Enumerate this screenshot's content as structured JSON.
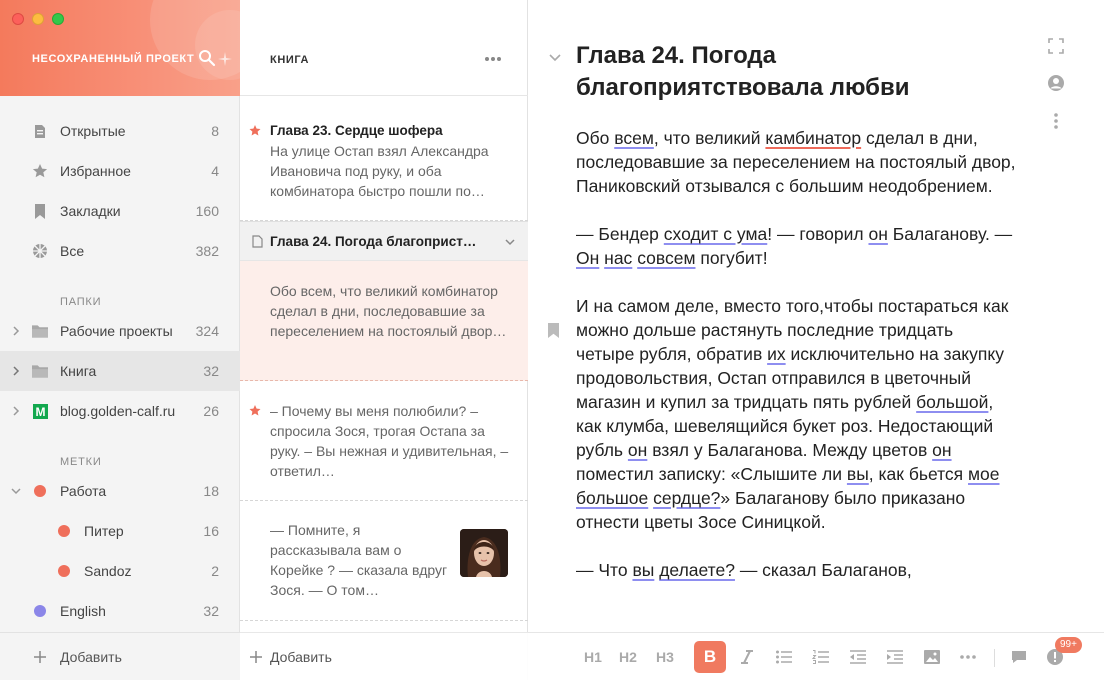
{
  "sidebar": {
    "project_title": "НЕСОХРАНЕННЫЙ ПРОЕКТ",
    "items": [
      {
        "label": "Открытые",
        "count": "8",
        "icon": "doc-icon"
      },
      {
        "label": "Избранное",
        "count": "4",
        "icon": "star-icon"
      },
      {
        "label": "Закладки",
        "count": "160",
        "icon": "bookmark-icon"
      },
      {
        "label": "Все",
        "count": "382",
        "icon": "all-notes-icon"
      }
    ],
    "folders_heading": "ПАПКИ",
    "folders": [
      {
        "label": "Рабочие проекты",
        "count": "324",
        "icon": "folder-icon"
      },
      {
        "label": "Книга",
        "count": "32",
        "icon": "folder-icon"
      },
      {
        "label": "blog.golden-calf.ru",
        "count": "26",
        "icon": "medium-icon"
      }
    ],
    "tags_heading": "МЕТКИ",
    "tags": [
      {
        "label": "Работа",
        "count": "18",
        "color": "#ef6f5b"
      },
      {
        "label": "Питер",
        "count": "16",
        "color": "#ef6f5b"
      },
      {
        "label": "Sandoz",
        "count": "2",
        "color": "#ef6f5b"
      },
      {
        "label": "English",
        "count": "32",
        "color": "#8b86e8"
      }
    ],
    "add_label": "Добавить"
  },
  "notelist": {
    "title": "КНИГА",
    "notes": [
      {
        "title": "Глава 23. Сердце шофера",
        "snippet": "На улице Остап взял Александра Ивановича под руку, и обa комбинатора быстро пошли по…"
      },
      {
        "title": "Глава 24. Погода благоприст…",
        "snippet": "Обо всем, что великий комбинатор сделал в дни, последовавшие за переселением на постоялый двор…"
      },
      {
        "snippet": "– Почему вы меня полюбили? – спросила Зося, трогая Остапа за руку. – Вы нежная и удивительная, – ответил…"
      },
      {
        "snippet": "— Помните, я рассказывала вам о Корейке ? — сказала вдруг Зося. — О том…"
      }
    ],
    "add_label": "Добавить"
  },
  "editor": {
    "title": "Глава 24. Погода благоприятствовала любви",
    "toolbar": {
      "h1": "H1",
      "h2": "H2",
      "h3": "H3",
      "bold": "B",
      "badge": "99+"
    }
  },
  "colors": {
    "accent": "#f07a60",
    "underline_blue": "#8e8ef0",
    "underline_red": "#ef6a5a"
  }
}
